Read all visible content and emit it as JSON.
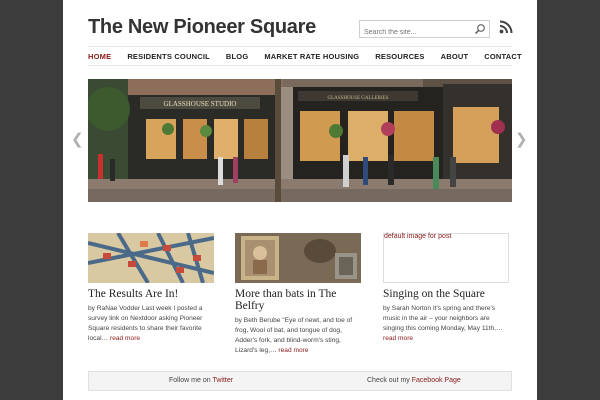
{
  "site": {
    "title": "The New Pioneer Square"
  },
  "search": {
    "placeholder": "Search the site..."
  },
  "nav": [
    {
      "label": "HOME",
      "active": true
    },
    {
      "label": "RESIDENTS COUNCIL"
    },
    {
      "label": "BLOG"
    },
    {
      "label": "MARKET RATE HOUSING"
    },
    {
      "label": "RESOURCES"
    },
    {
      "label": "ABOUT"
    },
    {
      "label": "CONTACT"
    }
  ],
  "slider": {
    "signs": [
      "GLASSHOUSE STUDIO",
      "GLASSHOUSE GALLERIES"
    ]
  },
  "posts": [
    {
      "title": "The Results Are In!",
      "excerpt": "by RaNae Vodder Last week I posted a survey link on  Nextdoor asking Pioneer Square residents to share their favorite local…",
      "more": "read more"
    },
    {
      "title": "More than bats in The Belfry",
      "excerpt": "by Beth Berube \"Eye of newt, and toe of frog, Wool of bat, and tongue of dog, Adder's fork, and blind-worm's sting, Lizard's leg,…",
      "more": "read more"
    },
    {
      "image_alt": "default image for post",
      "title": "Singing on the Square",
      "excerpt": "by Sarah Norton It's spring and there's music in the air – your neighbors are singing this coming Monday, May 11th,…",
      "more": "read more"
    }
  ],
  "footer": {
    "twitter_prefix": "Follow me on ",
    "twitter_link": "Twitter",
    "facebook_prefix": "Check out my ",
    "facebook_link": "Facebook Page"
  },
  "colors": {
    "accent": "#8a1a1a",
    "background": "#3c3c3c",
    "rss": "#444444"
  }
}
